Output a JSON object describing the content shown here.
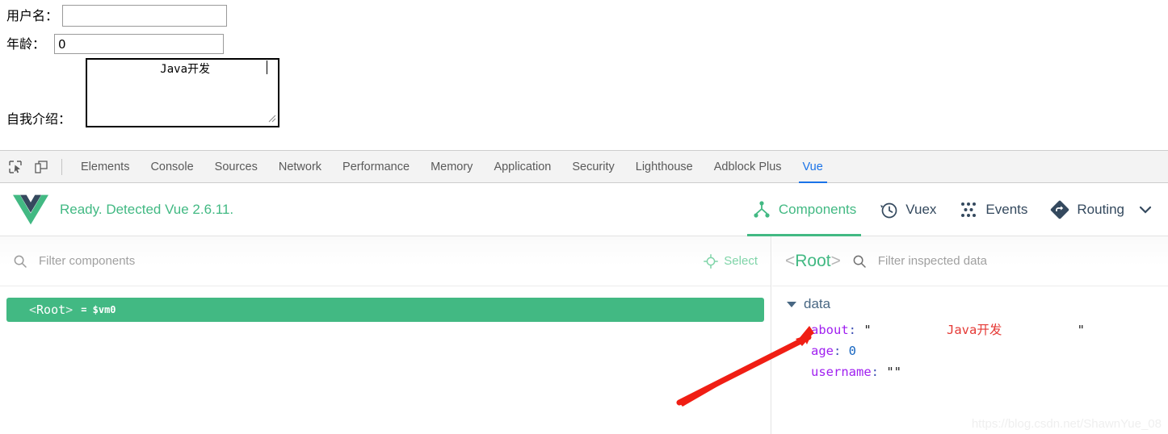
{
  "form": {
    "username": {
      "label": "用户名：",
      "value": "",
      "placeholder": ""
    },
    "age": {
      "label": "年龄：",
      "value": "0",
      "placeholder": ""
    },
    "about": {
      "label": "自我介绍：",
      "value": "          Java开发",
      "placeholder": ""
    }
  },
  "devtools": {
    "icons": {
      "inspect": "inspect-element-icon",
      "device": "device-toolbar-icon"
    },
    "tabs": [
      {
        "label": "Elements",
        "active": false
      },
      {
        "label": "Console",
        "active": false
      },
      {
        "label": "Sources",
        "active": false
      },
      {
        "label": "Network",
        "active": false
      },
      {
        "label": "Performance",
        "active": false
      },
      {
        "label": "Memory",
        "active": false
      },
      {
        "label": "Application",
        "active": false
      },
      {
        "label": "Security",
        "active": false
      },
      {
        "label": "Lighthouse",
        "active": false
      },
      {
        "label": "Adblock Plus",
        "active": false
      },
      {
        "label": "Vue",
        "active": true
      }
    ],
    "accent_color": "#1a73e8"
  },
  "vue_panel": {
    "status_text": "Ready. Detected Vue 2.6.11.",
    "brand_color": "#42b983",
    "logo_dark": "#35495e",
    "navs": [
      {
        "label": "Components",
        "icon": "components-tree-icon",
        "active": true
      },
      {
        "label": "Vuex",
        "icon": "clock-history-icon",
        "active": false
      },
      {
        "label": "Events",
        "icon": "events-dots-icon",
        "active": false
      },
      {
        "label": "Routing",
        "icon": "routing-diamond-icon",
        "active": false
      }
    ],
    "more_icon": "chevron-down-icon"
  },
  "components_pane": {
    "filter_placeholder": "Filter components",
    "filter_value": "",
    "search_icon": "search-icon",
    "select_button": {
      "label": "Select",
      "icon": "target-crosshair-icon"
    },
    "tree": [
      {
        "name": "<Root>",
        "name_open": "<",
        "name_core": "Root",
        "name_close": ">",
        "vm": "= $vm0",
        "selected": true
      }
    ]
  },
  "inspector_pane": {
    "root_tag": {
      "open": "<",
      "core": "Root",
      "close": ">"
    },
    "search_icon": "search-icon",
    "filter_placeholder": "Filter inspected data",
    "filter_value": "",
    "section": {
      "label": "data",
      "expanded": true,
      "toggle_icon": "triangle-down-icon"
    },
    "entries": [
      {
        "key": "about",
        "type": "string",
        "quoted": true,
        "value": "          Java开发          "
      },
      {
        "key": "age",
        "type": "number",
        "quoted": false,
        "value": "0"
      },
      {
        "key": "username",
        "type": "string",
        "quoted": true,
        "value": ""
      }
    ]
  },
  "annotation": {
    "arrow_color": "#f01e14",
    "arrow_name": "red-pointer-arrow"
  },
  "watermark": {
    "text": "https://blog.csdn.net/ShawnYue_08"
  }
}
